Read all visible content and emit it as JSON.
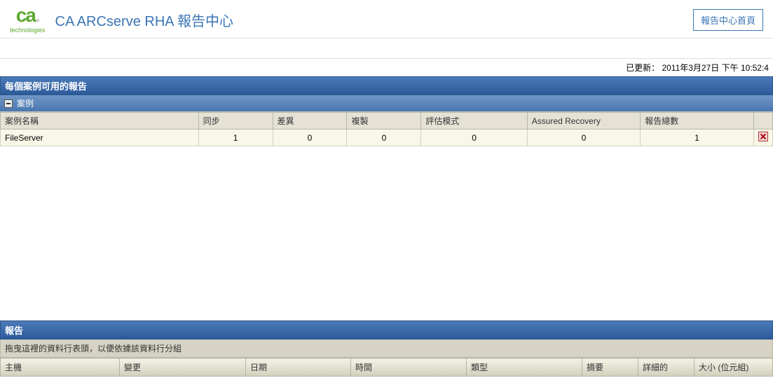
{
  "header": {
    "logo_text": "ca",
    "logo_subtext": "technologies",
    "app_title": "CA ARCserve RHA 報告中心",
    "home_button": "報告中心首頁"
  },
  "status": {
    "updated_label": "已更新：",
    "updated_value": "2011年3月27日 下午 10:52:4"
  },
  "scenarios": {
    "section_title": "每個案例可用的報告",
    "group_label": "案例",
    "columns": {
      "name": "案例名稱",
      "sync": "同步",
      "diff": "差異",
      "replicate": "複製",
      "assess": "評估模式",
      "ar": "Assured Recovery",
      "total": "報告總數"
    },
    "rows": [
      {
        "name": "FileServer",
        "sync": "1",
        "diff": "0",
        "replicate": "0",
        "assess": "0",
        "ar": "0",
        "total": "1"
      }
    ]
  },
  "reports": {
    "section_title": "報告",
    "drag_hint": "拖曳這裡的資料行表頭，以便依據該資料行分組",
    "columns": {
      "host": "主機",
      "change": "變更",
      "date": "日期",
      "time": "時間",
      "type": "類型",
      "summary": "摘要",
      "detail": "詳細的",
      "size": "大小 (位元組)"
    }
  }
}
